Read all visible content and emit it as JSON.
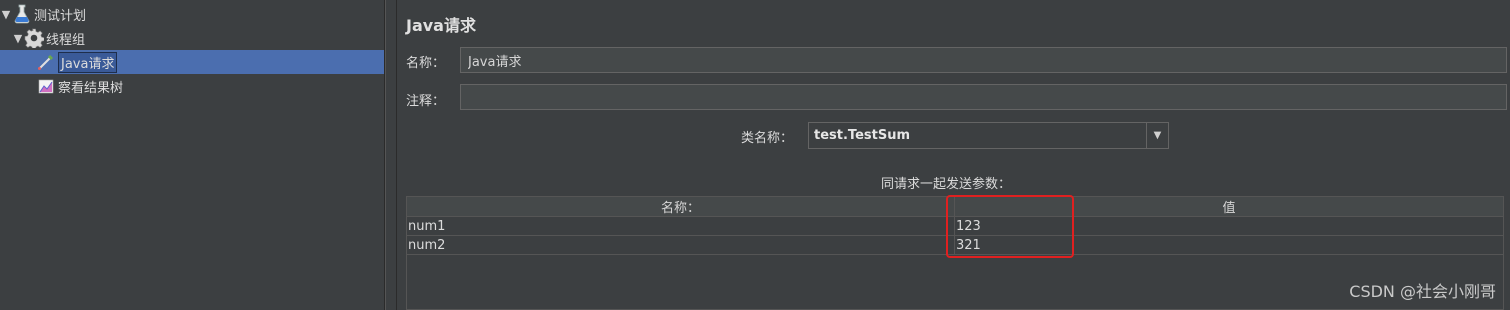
{
  "tree": {
    "items": [
      {
        "label": "测试计划",
        "icon": "flask-icon",
        "expanded": true
      },
      {
        "label": "线程组",
        "icon": "gear-icon",
        "expanded": true
      },
      {
        "label": "Java请求",
        "icon": "pipette-icon",
        "selected": true
      },
      {
        "label": "察看结果树",
        "icon": "chart-icon"
      }
    ]
  },
  "panel": {
    "title": "Java请求",
    "name_label": "名称：",
    "name_value": "Java请求",
    "comment_label": "注释：",
    "comment_value": "",
    "class_label": "类名称：",
    "class_value": "test.TestSum",
    "params_caption": "同请求一起发送参数：",
    "table": {
      "headers": [
        "名称：",
        "值"
      ],
      "rows": [
        [
          "num1",
          "123"
        ],
        [
          "num2",
          "321"
        ]
      ]
    }
  },
  "watermark": "CSDN @社会小刚哥",
  "colors": {
    "background": "#3c3f41",
    "selection": "#4b6eaf",
    "highlight": "#e02020"
  }
}
